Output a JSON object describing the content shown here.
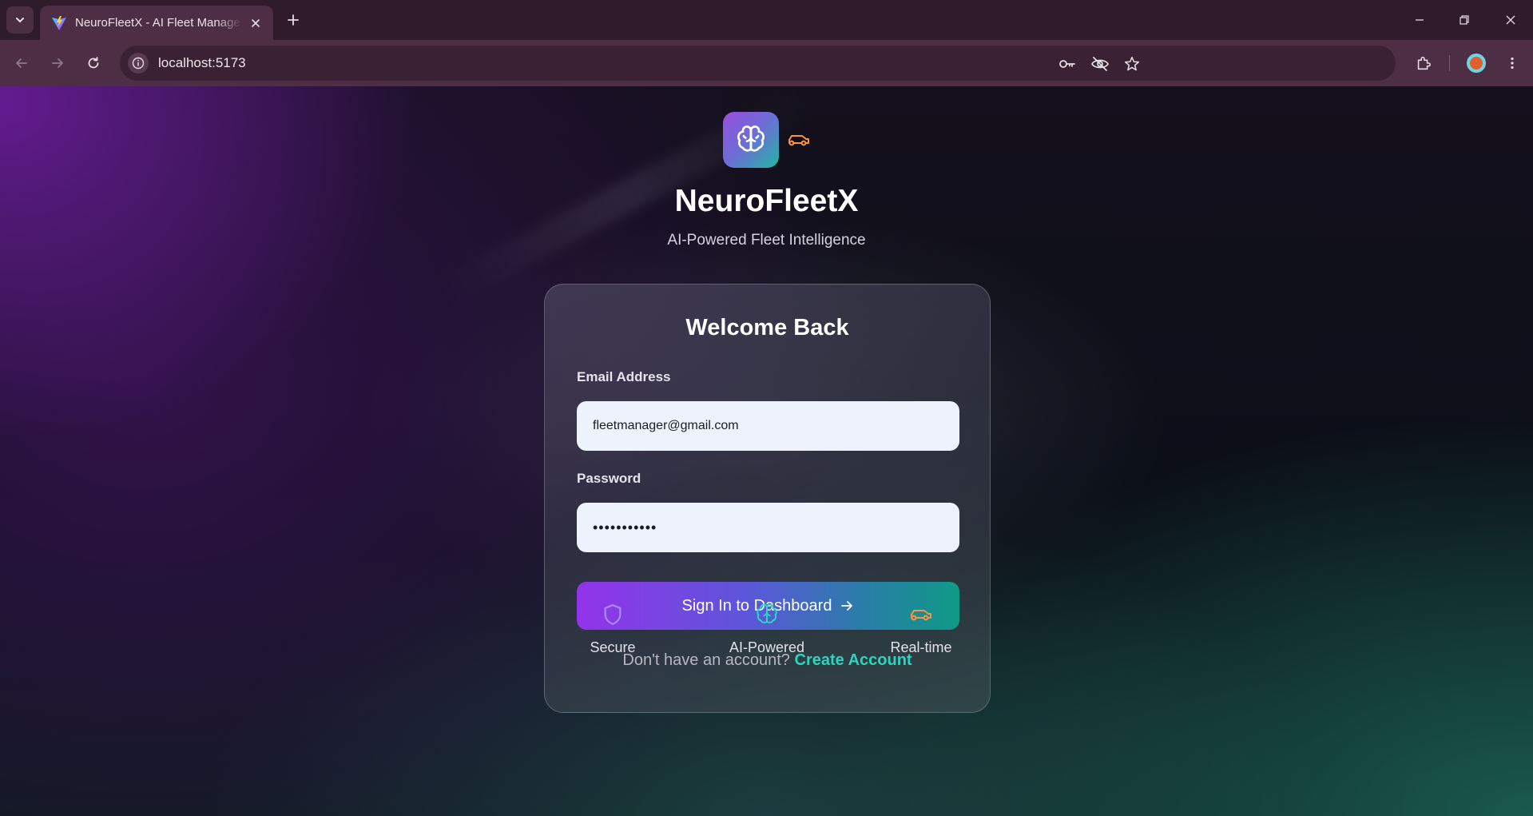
{
  "browser": {
    "tab_title": "NeuroFleetX - AI Fleet Management",
    "url": "localhost:5173"
  },
  "brand": {
    "title": "NeuroFleetX",
    "subtitle": "AI-Powered Fleet Intelligence",
    "logo_icon": "brain-icon",
    "logo_badge_icon": "car-icon"
  },
  "login": {
    "heading": "Welcome Back",
    "email_label": "Email Address",
    "email_value": "fleetmanager@gmail.com",
    "password_label": "Password",
    "password_value": "fleetpass12",
    "submit_label": "Sign In to Dashboard",
    "no_account_text": "Don't have an account?",
    "create_account_label": "Create Account"
  },
  "features": [
    {
      "label": "Secure",
      "icon": "shield-icon",
      "color": "#a78bfa"
    },
    {
      "label": "AI-Powered",
      "icon": "brain-icon",
      "color": "#2dd4bf"
    },
    {
      "label": "Real-time",
      "icon": "car-icon",
      "color": "#fb923c"
    }
  ],
  "colors": {
    "accent_purple": "#9333ea",
    "accent_teal": "#0f9a86",
    "link": "#2dd4bf",
    "car_orange": "#fb923c"
  }
}
